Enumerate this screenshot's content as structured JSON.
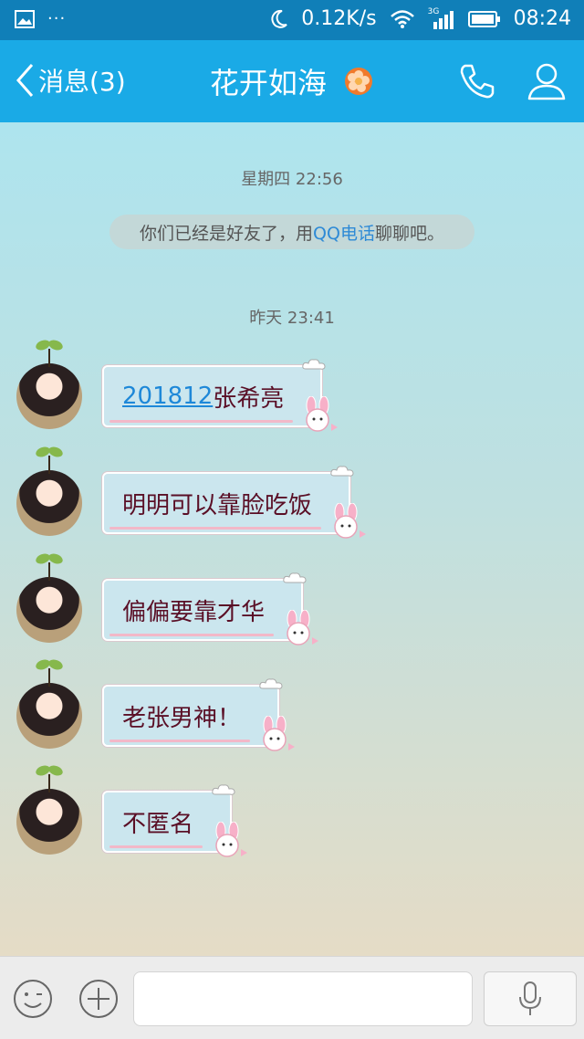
{
  "status_bar": {
    "speed": "0.12K/s",
    "network": "3G",
    "time": "08:24",
    "icons": [
      "image-icon",
      "more-dots-icon",
      "moon-icon",
      "wifi-icon",
      "signal-icon",
      "battery-icon"
    ]
  },
  "nav": {
    "back_label": "消息(3)",
    "title": "花开如海",
    "icons": [
      "back-chevron-icon",
      "flower-icon",
      "phone-icon",
      "contact-icon"
    ],
    "accent": "#1aaae6"
  },
  "chat": {
    "timestamps": [
      "星期四 22:56",
      "昨天 23:41"
    ],
    "system_message": {
      "before": "你们已经是好友了，用",
      "link": "QQ电话",
      "after": "聊聊吧。"
    },
    "messages": [
      {
        "link": "201812",
        "text": "张希亮"
      },
      {
        "link": "",
        "text": "明明可以靠脸吃饭"
      },
      {
        "link": "",
        "text": "偏偏要靠才华"
      },
      {
        "link": "",
        "text": "老张男神！"
      },
      {
        "link": "",
        "text": "不匿名"
      }
    ]
  },
  "input_bar": {
    "text_value": "",
    "icons": [
      "emoji-icon",
      "plus-icon",
      "microphone-icon"
    ]
  }
}
